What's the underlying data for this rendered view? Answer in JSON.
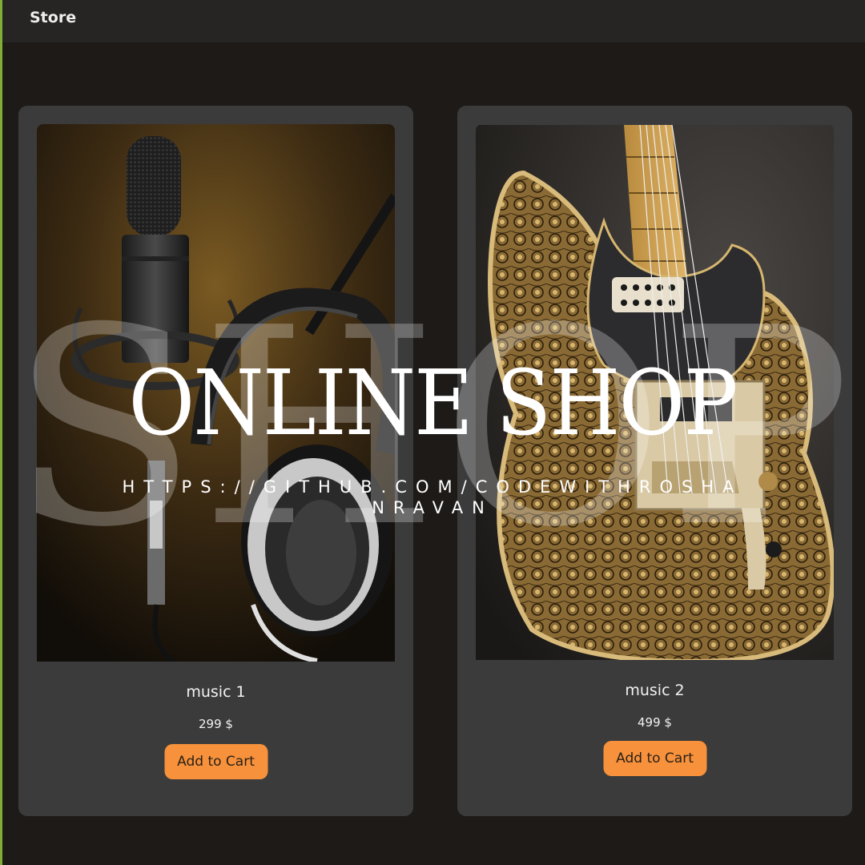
{
  "header": {
    "brand": "Store"
  },
  "products": [
    {
      "title": "music 1",
      "price": "299 $",
      "button_label": "Add to Cart",
      "image": "microphone-headphones-photo"
    },
    {
      "title": "music 2",
      "price": "499 $",
      "button_label": "Add to Cart",
      "image": "paisley-guitar-photo"
    }
  ],
  "watermark": {
    "big": "SHOP",
    "title": "ONLINE SHOP",
    "url": "HTTPS://GITHUB.COM/CODEWITHROSHANRAVAN"
  },
  "colors": {
    "background": "#1d1a18",
    "topbar": "#262524",
    "card": "#3b3b3b",
    "button": "#f7913b",
    "accent_edge": "#7fae35"
  }
}
